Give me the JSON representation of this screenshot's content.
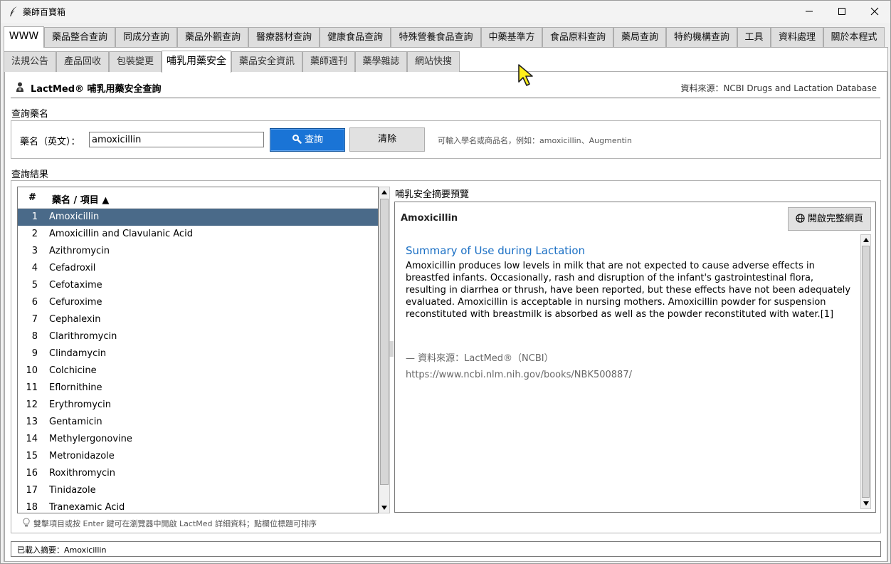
{
  "window": {
    "title": "藥師百寶箱",
    "icon": "feather-icon",
    "controls": [
      "minimize",
      "maximize",
      "close"
    ]
  },
  "main_tabs": [
    {
      "label": "WWW",
      "active": true
    },
    {
      "label": "藥品整合查詢"
    },
    {
      "label": "同成分查詢"
    },
    {
      "label": "藥品外觀查詢"
    },
    {
      "label": "醫療器材查詢"
    },
    {
      "label": "健康食品查詢"
    },
    {
      "label": "特殊營養食品查詢"
    },
    {
      "label": "中藥基準方"
    },
    {
      "label": "食品原料查詢"
    },
    {
      "label": "藥局查詢"
    },
    {
      "label": "特約機構查詢"
    },
    {
      "label": "工具"
    },
    {
      "label": "資料處理"
    },
    {
      "label": "關於本程式"
    }
  ],
  "sub_tabs": [
    {
      "label": "法規公告"
    },
    {
      "label": "產品回收"
    },
    {
      "label": "包裝變更"
    },
    {
      "label": "哺乳用藥安全",
      "active": true
    },
    {
      "label": "藥品安全資訊"
    },
    {
      "label": "藥師週刊"
    },
    {
      "label": "藥學雜誌"
    },
    {
      "label": "網站快搜"
    }
  ],
  "header": {
    "title": "LactMed® 哺乳用藥安全查詢",
    "source": "資料來源：NCBI Drugs and Lactation Database"
  },
  "query": {
    "section_label": "查詢藥名",
    "field_label": "藥名（英文）：",
    "value": "amoxicillin",
    "search_label": "查詢",
    "clear_label": "清除",
    "hint": "可輸入學名或商品名，例如：amoxicillin、Augmentin"
  },
  "results": {
    "section_label": "查詢結果",
    "col_num": "#",
    "col_name": "藥名 / 項目 ▲",
    "selected_index": 0,
    "items": [
      {
        "num": "1",
        "name": "Amoxicillin"
      },
      {
        "num": "2",
        "name": "Amoxicillin and Clavulanic Acid"
      },
      {
        "num": "3",
        "name": "Azithromycin"
      },
      {
        "num": "4",
        "name": "Cefadroxil"
      },
      {
        "num": "5",
        "name": "Cefotaxime"
      },
      {
        "num": "6",
        "name": "Cefuroxime"
      },
      {
        "num": "7",
        "name": "Cephalexin"
      },
      {
        "num": "8",
        "name": "Clarithromycin"
      },
      {
        "num": "9",
        "name": "Clindamycin"
      },
      {
        "num": "10",
        "name": "Colchicine"
      },
      {
        "num": "11",
        "name": "Eflornithine"
      },
      {
        "num": "12",
        "name": "Erythromycin"
      },
      {
        "num": "13",
        "name": "Gentamicin"
      },
      {
        "num": "14",
        "name": "Methylergonovine"
      },
      {
        "num": "15",
        "name": "Metronidazole"
      },
      {
        "num": "16",
        "name": "Roxithromycin"
      },
      {
        "num": "17",
        "name": "Tinidazole"
      },
      {
        "num": "18",
        "name": "Tranexamic Acid"
      }
    ]
  },
  "preview": {
    "section_label": "哺乳安全摘要預覽",
    "drug_name": "Amoxicillin",
    "open_button_label": "開啟完整網頁",
    "summary_heading": "Summary of Use during Lactation",
    "summary_text": "Amoxicillin produces low levels in milk that are not expected to cause adverse effects in breastfed infants. Occasionally, rash and disruption of the infant's gastrointestinal flora, resulting in diarrhea or thrush, have been reported, but these effects have not been adequately evaluated. Amoxicillin is acceptable in nursing mothers. Amoxicillin powder for suspension reconstituted with breastmilk is absorbed as well as the powder reconstituted with water.[1]",
    "source_line": "— 資料來源：LactMed®（NCBI）",
    "source_url": "https://www.ncbi.nlm.nih.gov/books/NBK500887/"
  },
  "tip": "雙擊項目或按 Enter 鍵可在瀏覽器中開啟 LactMed 詳細資料；點欄位標題可排序",
  "status": "已載入摘要：Amoxicillin",
  "colors": {
    "selected_row": "#4a6a89",
    "primary_button": "#1a74d6",
    "summary_heading": "#1a6fc4"
  }
}
